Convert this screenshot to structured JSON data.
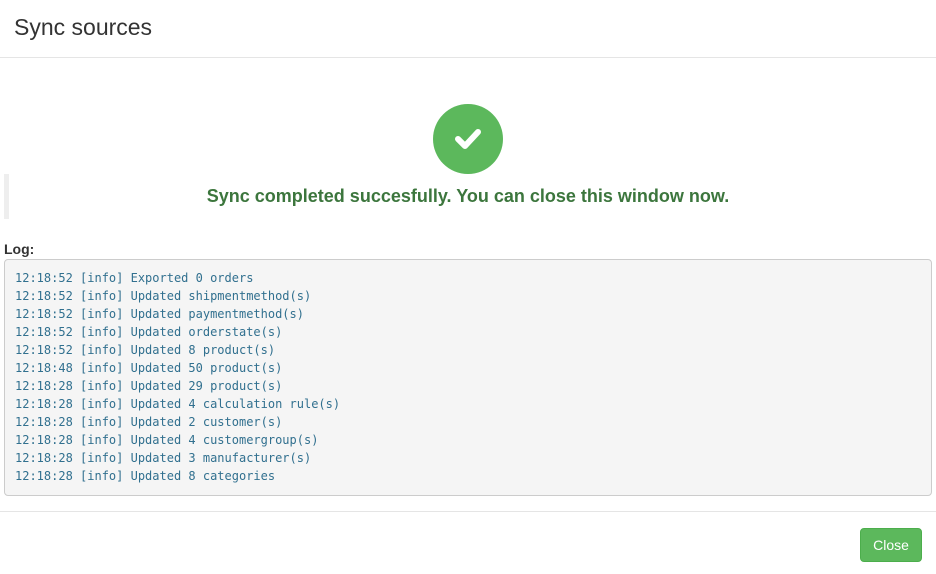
{
  "header": {
    "title": "Sync sources"
  },
  "status": {
    "icon": "check-icon",
    "color": "#5cb85c",
    "message": "Sync completed succesfully. You can close this window now.",
    "message_color": "#3c763d"
  },
  "log": {
    "label": "Log:",
    "lines": [
      "12:18:52 [info] Exported 0 orders",
      "12:18:52 [info] Updated shipmentmethod(s)",
      "12:18:52 [info] Updated paymentmethod(s)",
      "12:18:52 [info] Updated orderstate(s)",
      "12:18:52 [info] Updated 8 product(s)",
      "12:18:48 [info] Updated 50 product(s)",
      "12:18:28 [info] Updated 29 product(s)",
      "12:18:28 [info] Updated 4 calculation rule(s)",
      "12:18:28 [info] Updated 2 customer(s)",
      "12:18:28 [info] Updated 4 customergroup(s)",
      "12:18:28 [info] Updated 3 manufacturer(s)",
      "12:18:28 [info] Updated 8 categories"
    ]
  },
  "footer": {
    "close_label": "Close",
    "close_color": "#5cb85c"
  }
}
